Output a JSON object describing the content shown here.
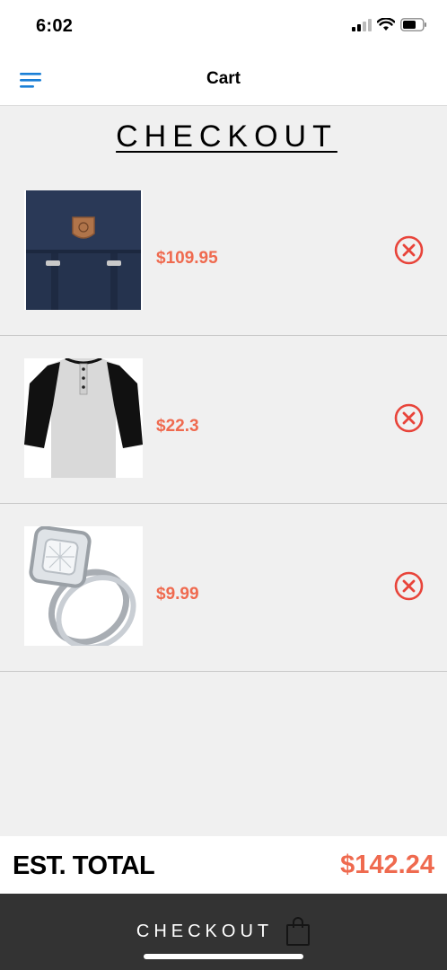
{
  "status_bar": {
    "time": "6:02"
  },
  "nav": {
    "title": "Cart",
    "menu_icon": "hamburger-menu-icon"
  },
  "page": {
    "heading": "CHECKOUT"
  },
  "cart": {
    "items": [
      {
        "price": "$109.95",
        "image": "navy-backpack"
      },
      {
        "price": "$22.3",
        "image": "raglan-henley-shirt"
      },
      {
        "price": "$9.99",
        "image": "diamond-ring-set"
      }
    ],
    "remove_icon": "remove-circle-x-icon"
  },
  "total": {
    "label": "EST. TOTAL",
    "value": "$142.24"
  },
  "checkout": {
    "label": "CHECKOUT",
    "icon": "shopping-bag-icon"
  },
  "colors": {
    "accent": "#ef6a4f",
    "nav_icon": "#1a7fd6",
    "checkout_bg": "#333333",
    "page_bg": "#f0f0f0"
  }
}
